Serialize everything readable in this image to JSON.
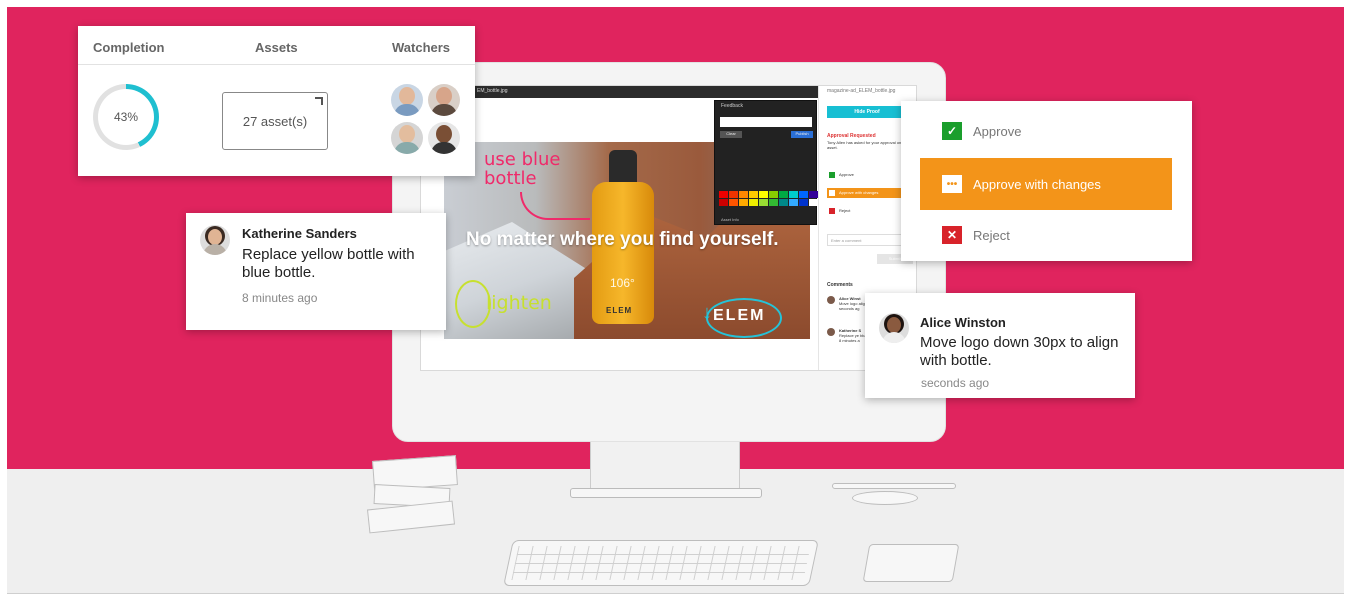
{
  "stats": {
    "completion_header": "Completion",
    "assets_header": "Assets",
    "watchers_header": "Watchers",
    "completion_value": "43%",
    "completion_percent": 43,
    "assets_value": "27 asset(s)",
    "watchers": [
      "watcher-1",
      "watcher-2",
      "watcher-3",
      "watcher-4"
    ]
  },
  "comment_katherine": {
    "name": "Katherine Sanders",
    "text": "Replace yellow bottle with blue bottle.",
    "time": "8 minutes ago"
  },
  "comment_alice": {
    "name": "Alice Winston",
    "text": "Move logo down 30px to align with bottle.",
    "time": "seconds ago"
  },
  "approval_menu": {
    "approve": "Approve",
    "approve_with_changes": "Approve with changes",
    "reject": "Reject",
    "selected": "Approve with changes"
  },
  "proof": {
    "file_name": "EM_bottle.jpg",
    "headline": "No matter where you find yourself.",
    "annotation_blue": "use blue bottle",
    "annotation_lighten": "lighten",
    "bottle_temp": "106°",
    "brand_logo": "ELEM"
  },
  "feedback_panel": {
    "title": "Feedback",
    "placeholder": "Add feedback",
    "clear_label": "Clear",
    "publish_label": "Publish",
    "asset_info": "Asset Info"
  },
  "side_panel": {
    "file_name": "magazine-ad_ELEM_bottle.jpg",
    "hide_proof": "Hide Proof",
    "approval_requested": "Approval Requested",
    "request_desc": "Tony Allen has asked for your approval on this asset.",
    "opt_approve": "Approve",
    "opt_changes": "Approve with changes",
    "opt_reject": "Reject",
    "comment_placeholder": "Enter a comment",
    "submit": "Submit",
    "comments_title": "Comments",
    "c1_name": "Alice Winst",
    "c1_text": "Move logo align with",
    "c1_time": "seconds ag",
    "c2_name": "Katherine S",
    "c2_text": "Replace ye blue bottle",
    "c2_time": "8 minutes a"
  },
  "colors": {
    "background": "#e0245e",
    "accent_cyan": "#1fbfd0",
    "accent_orange": "#f39419",
    "approve_green": "#1a9e2c",
    "reject_red": "#d8232a"
  },
  "icons": {
    "approve": "checkmark-icon",
    "changes": "ellipsis-icon",
    "reject": "x-icon"
  }
}
